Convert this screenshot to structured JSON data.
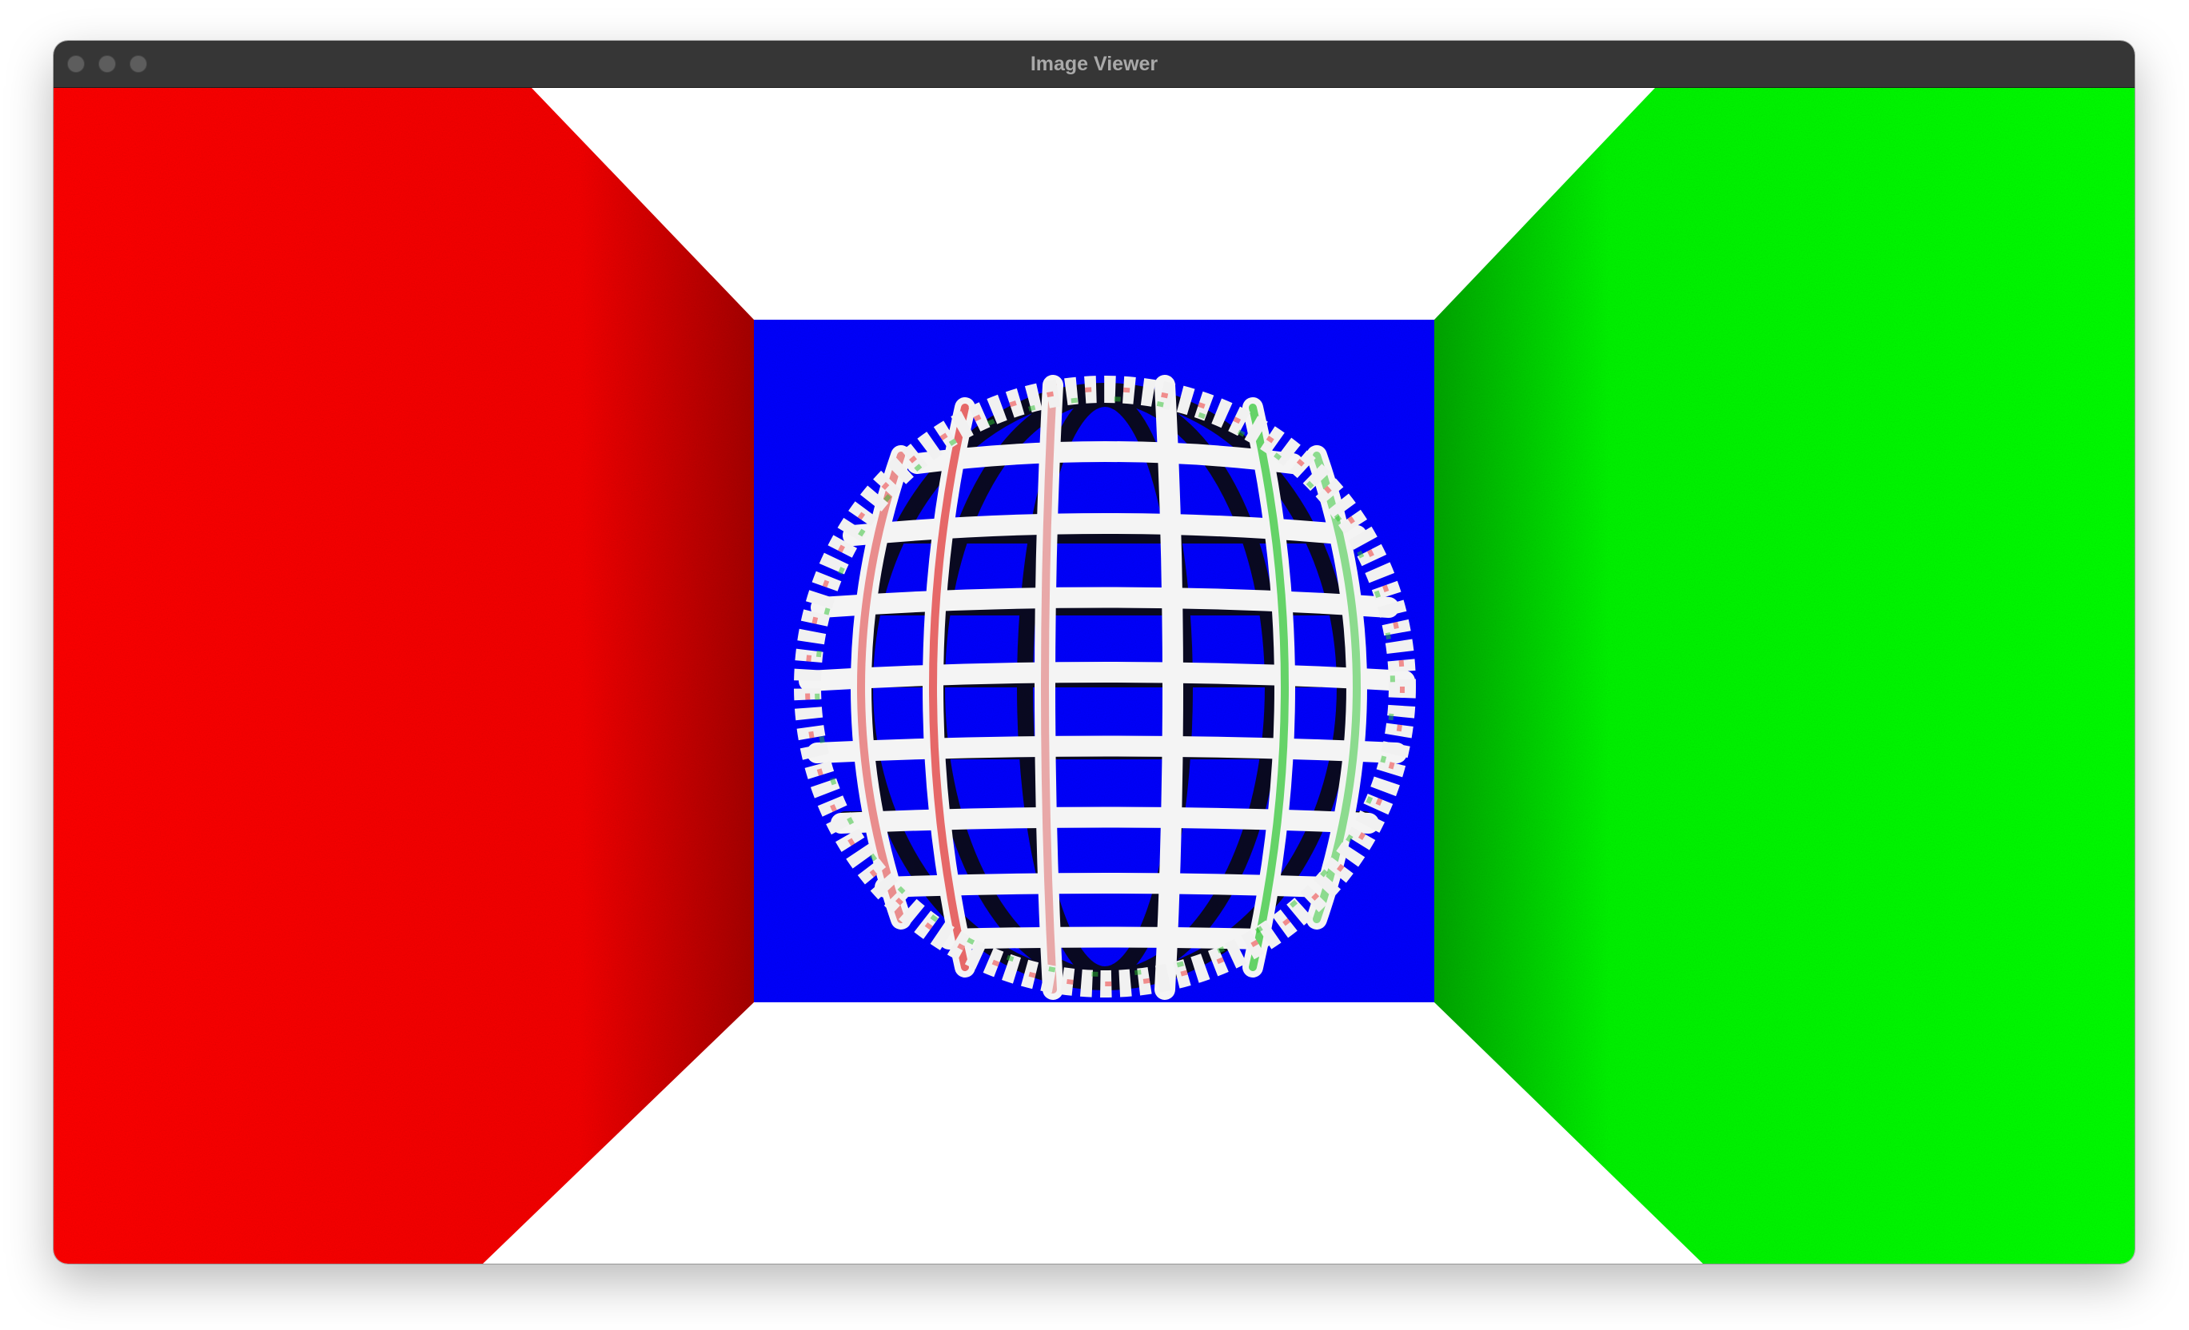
{
  "window": {
    "title": "Image Viewer",
    "traffic_lights": [
      "close",
      "minimize",
      "zoom"
    ]
  },
  "image": {
    "description_icon": "rendered-image",
    "colors": {
      "left_wall": "#ff0000",
      "right_wall": "#00ff00",
      "back_wall": "#0000ff",
      "floor_ceiling": "#ffffff",
      "titlebar": "#363636"
    }
  }
}
